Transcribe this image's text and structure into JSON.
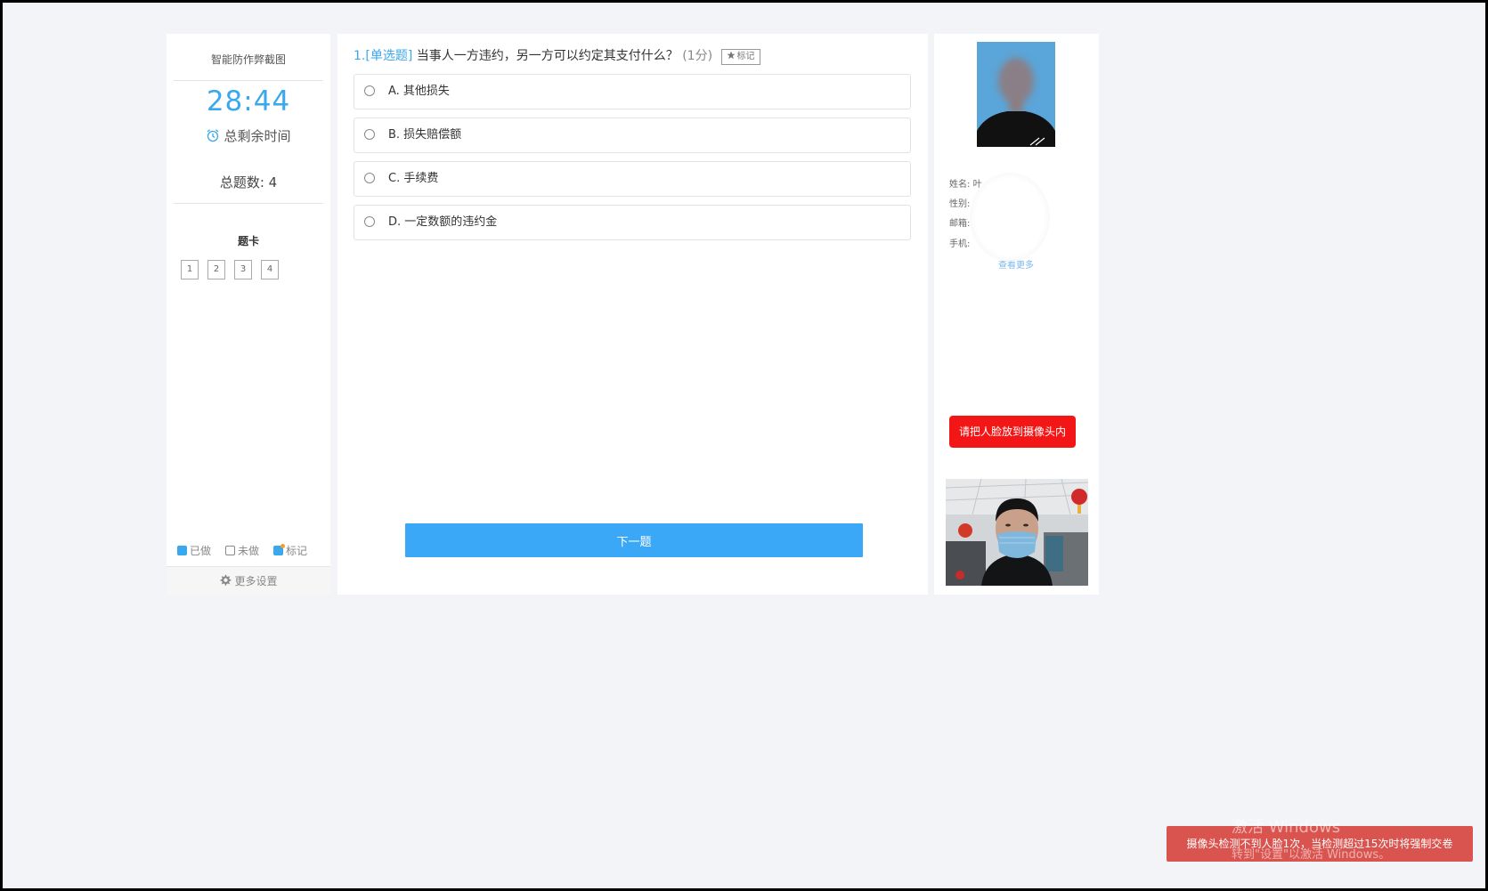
{
  "sidebar": {
    "anti_cheat_title": "智能防作弊截图",
    "timer": "28:44",
    "remaining_label": "总剩余时间",
    "total_label": "总题数: 4",
    "card_title": "题卡",
    "cards": [
      "1",
      "2",
      "3",
      "4"
    ],
    "legend": {
      "done": "已做",
      "undone": "未做",
      "marked": "标记"
    },
    "settings_label": "更多设置"
  },
  "question": {
    "number": "1.",
    "type": "[单选题]",
    "text": "当事人一方违约，另一方可以约定其支付什么？",
    "score": "(1分)",
    "mark_label": "标记",
    "options": [
      {
        "label": "A. 其他损失"
      },
      {
        "label": "B. 损失赔偿额"
      },
      {
        "label": "C. 手续费"
      },
      {
        "label": "D. 一定数额的违约金"
      }
    ],
    "next_label": "下一题"
  },
  "profile": {
    "name_label": "姓名:",
    "name_value": "叶",
    "gender_label": "性别:",
    "email_label": "邮箱:",
    "phone_label": "手机:",
    "see_more": "查看更多",
    "face_warning": "请把人脸放到摄像头内"
  },
  "toast": {
    "message": "摄像头检测不到人脸1次，当检测超过15次时将强制交卷"
  },
  "watermark": {
    "line1": "激活 Windows",
    "line2": "转到\"设置\"以激活 Windows。"
  },
  "colors": {
    "accent": "#3aa8ec",
    "button": "#3aa8f7",
    "warning": "#f21616",
    "toast": "#d9534f",
    "background": "#f3f4f7"
  }
}
